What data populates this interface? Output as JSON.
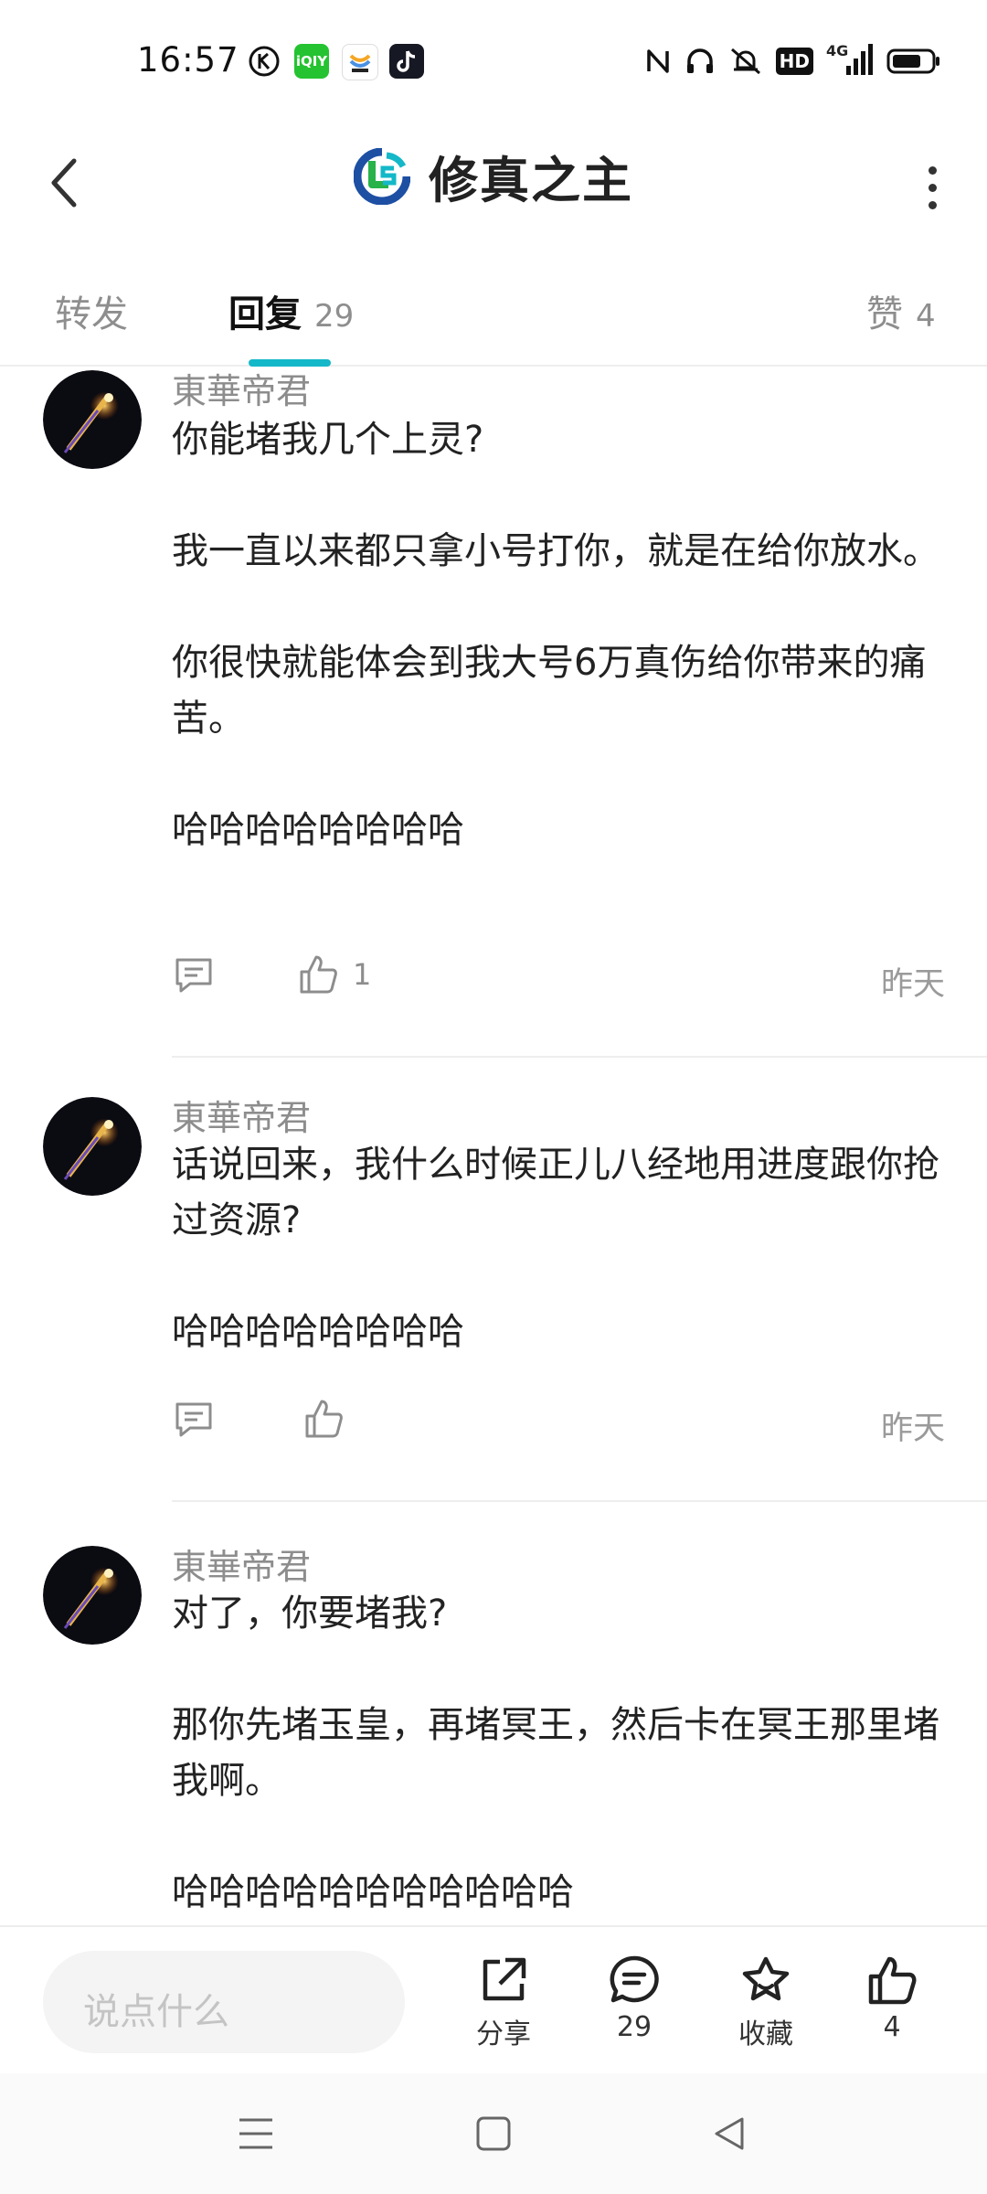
{
  "status_bar": {
    "time": "16:57",
    "app_icons": [
      "k-icon",
      "iqiyi-icon",
      "app-icon",
      "tiktok-icon"
    ],
    "iqiyi_label": "iQIY",
    "right_icons": [
      "nfc-icon",
      "headset-icon",
      "mute-icon",
      "hd-icon",
      "signal-4g-icon",
      "battery-icon"
    ],
    "hd_label": "HD",
    "network_label": "4G"
  },
  "header": {
    "title": "修真之主",
    "back_icon": "chevron-left-icon",
    "more_icon": "more-vertical-icon"
  },
  "tabs": [
    {
      "label": "转发",
      "count": "",
      "active": false
    },
    {
      "label": "回复",
      "count": "29",
      "active": true
    },
    {
      "label": "赞",
      "count": "4",
      "active": false
    }
  ],
  "comments": [
    {
      "author": "東華帝君",
      "paragraphs": [
        "你能堵我几个上灵?",
        "我一直以来都只拿小号打你，就是在给你放水。",
        "你很快就能体会到我大号6万真伤给你带来的痛苦。",
        "哈哈哈哈哈哈哈哈"
      ],
      "like_count": "1",
      "time": "昨天"
    },
    {
      "author": "東華帝君",
      "paragraphs": [
        "话说回来，我什么时候正儿八经地用进度跟你抢过资源?",
        "哈哈哈哈哈哈哈哈"
      ],
      "like_count": "",
      "time": "昨天"
    },
    {
      "author": "東崋帝君",
      "paragraphs": [
        "对了，你要堵我?",
        "那你先堵玉皇，再堵冥王，然后卡在冥王那里堵我啊。",
        "哈哈哈哈哈哈哈哈哈哈哈"
      ],
      "like_count": "",
      "time": ""
    }
  ],
  "bottom_bar": {
    "input_placeholder": "说点什么",
    "share_label": "分享",
    "comment_count": "29",
    "favorite_label": "收藏",
    "like_count": "4"
  },
  "nav_bar": {
    "icons": [
      "menu-icon",
      "home-square-icon",
      "back-triangle-icon"
    ]
  },
  "colors": {
    "accent": "#14b8c8",
    "text_primary": "#222222",
    "text_secondary": "#8d8d8d",
    "divider": "#eeeeee"
  }
}
